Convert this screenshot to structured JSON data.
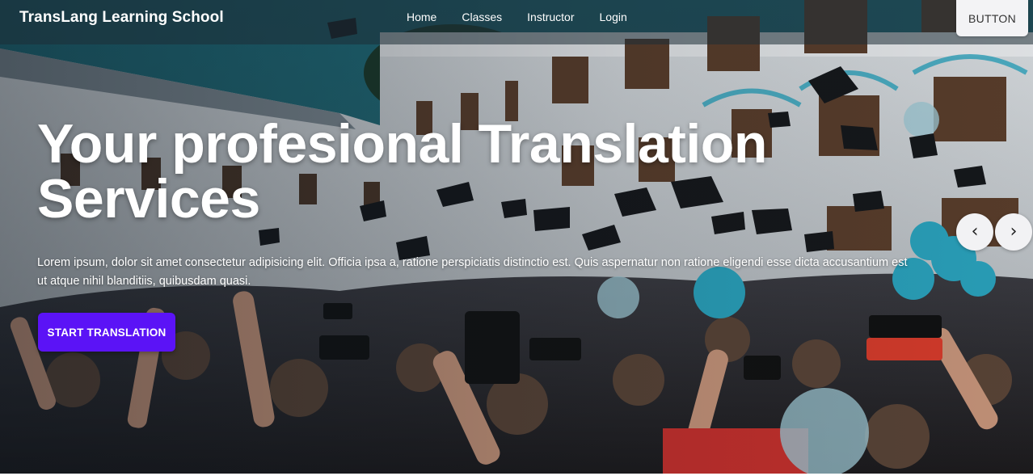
{
  "navbar": {
    "brand": "TransLang Learning School",
    "links": [
      "Home",
      "Classes",
      "Instructor",
      "Login"
    ],
    "button_label": "BUTTON"
  },
  "hero": {
    "headline": "Your profesional Translation Services",
    "description": "Lorem ipsum, dolor sit amet consectetur adipisicing elit. Officia ipsa a, ratione perspiciatis distinctio est. Quis aspernatur non ratione eligendi esse dicta accusantium est ut atque nihil blanditiis, quibusdam quasi.",
    "cta_label": "START TRANSLATION",
    "image": "graduation-crowd-photo"
  },
  "carousel": {
    "prev_icon": "chevron-left-icon",
    "prev_glyph": "‹",
    "next_icon": "chevron-right-icon",
    "next_glyph": "›"
  },
  "colors": {
    "accent": "#5b13f6",
    "nav_bg": "#1e2d37",
    "button_bg": "#f3f3f5",
    "balloon": "#2aa3bd"
  }
}
